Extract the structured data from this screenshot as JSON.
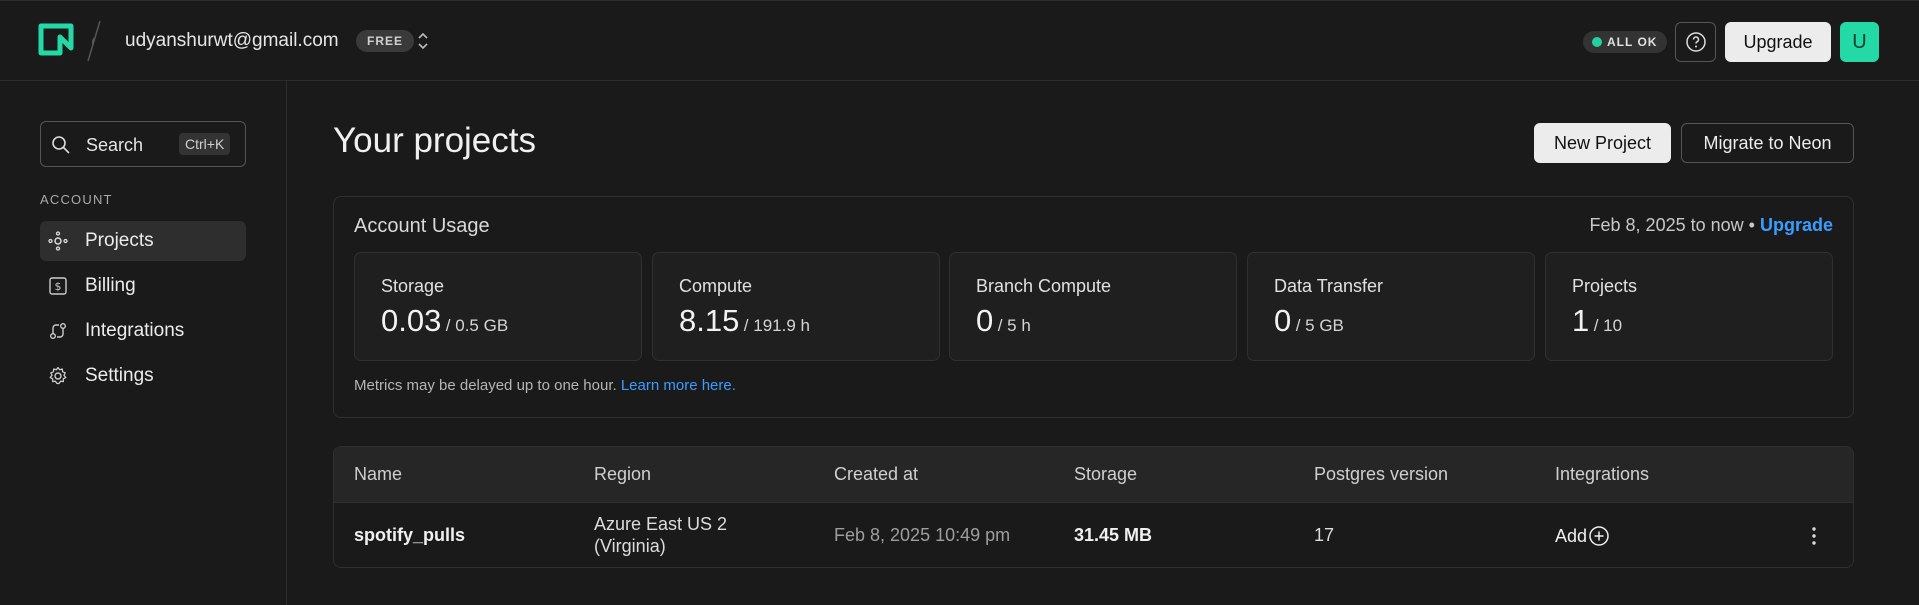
{
  "header": {
    "email": "udyanshurwt@gmail.com",
    "plan_badge": "FREE",
    "status": "ALL OK",
    "upgrade_label": "Upgrade",
    "avatar_initial": "U",
    "brand_color": "#23d9a5",
    "status_color": "#22d3a0"
  },
  "sidebar": {
    "search_label": "Search",
    "search_shortcut": "Ctrl+K",
    "section_label": "ACCOUNT",
    "items": [
      {
        "label": "Projects",
        "icon": "projects-icon",
        "active": true
      },
      {
        "label": "Billing",
        "icon": "billing-icon",
        "active": false
      },
      {
        "label": "Integrations",
        "icon": "integrations-icon",
        "active": false
      },
      {
        "label": "Settings",
        "icon": "gear-icon",
        "active": false
      }
    ]
  },
  "main": {
    "title": "Your projects",
    "new_project_label": "New Project",
    "migrate_label": "Migrate to Neon",
    "usage": {
      "title": "Account Usage",
      "range": "Feb 8, 2025 to now",
      "range_separator": "•",
      "range_link": "Upgrade",
      "cards": [
        {
          "label": "Storage",
          "value": "0.03",
          "limit": "/ 0.5 GB"
        },
        {
          "label": "Compute",
          "value": "8.15",
          "limit": "/ 191.9 h"
        },
        {
          "label": "Branch Compute",
          "value": "0",
          "limit": "/ 5 h"
        },
        {
          "label": "Data Transfer",
          "value": "0",
          "limit": "/ 5 GB"
        },
        {
          "label": "Projects",
          "value": "1",
          "limit": "/ 10"
        }
      ],
      "note": "Metrics may be delayed up to one hour.",
      "note_link": "Learn more here."
    },
    "table": {
      "columns": [
        "Name",
        "Region",
        "Created at",
        "Storage",
        "Postgres version",
        "Integrations"
      ],
      "rows": [
        {
          "name": "spotify_pulls",
          "region_line1": "Azure East US 2",
          "region_line2": "(Virginia)",
          "created_at": "Feb 8, 2025 10:49 pm",
          "storage": "31.45 MB",
          "postgres_version": "17",
          "integrations": "Add"
        }
      ]
    },
    "link_color": "#3b9cff"
  }
}
